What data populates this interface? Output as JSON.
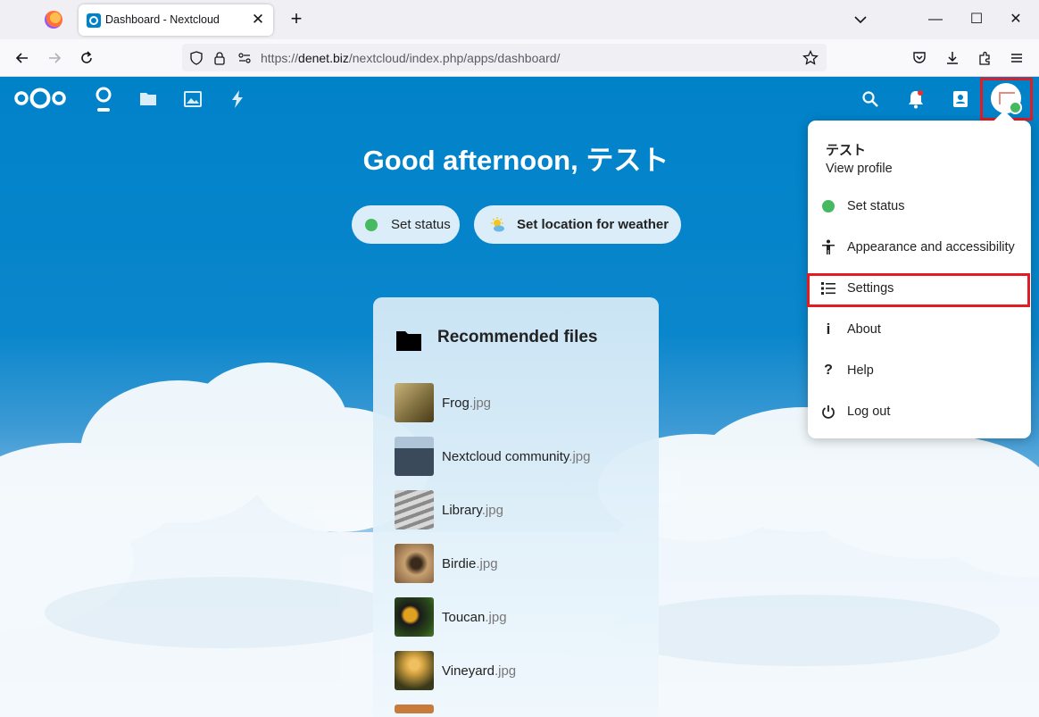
{
  "browser": {
    "tab_title": "Dashboard - Nextcloud",
    "tab_close": "✕",
    "new_tab": "+",
    "url_scheme": "https://",
    "url_host": "denet.biz",
    "url_path": "/nextcloud/index.php/apps/dashboard/",
    "window_minimize": "—",
    "window_maximize": "☐",
    "window_close": "✕"
  },
  "dashboard": {
    "greeting": "Good afternoon, テスト",
    "set_status": "Set status",
    "set_weather": "Set location for weather"
  },
  "recommended": {
    "title": "Recommended files",
    "files": [
      {
        "name": "Frog",
        "ext": ".jpg",
        "color1": "#7a6a3a",
        "color2": "#c9b27a"
      },
      {
        "name": "Nextcloud community",
        "ext": ".jpg",
        "color1": "#3a4a5a",
        "color2": "#8a9aaa"
      },
      {
        "name": "Library",
        "ext": ".jpg",
        "color1": "#8a8a8a",
        "color2": "#d8d8d8"
      },
      {
        "name": "Birdie",
        "ext": ".jpg",
        "color1": "#7a5a3a",
        "color2": "#c8a070"
      },
      {
        "name": "Toucan",
        "ext": ".jpg",
        "color1": "#2a4a1a",
        "color2": "#e0a020"
      },
      {
        "name": "Vineyard",
        "ext": ".jpg",
        "color1": "#3a3a1a",
        "color2": "#d0a040"
      }
    ]
  },
  "user_menu": {
    "display_name": "テスト",
    "view_profile": "View profile",
    "items": [
      {
        "label": "Set status"
      },
      {
        "label": "Appearance and accessibility"
      },
      {
        "label": "Settings"
      },
      {
        "label": "About"
      },
      {
        "label": "Help"
      },
      {
        "label": "Log out"
      }
    ]
  },
  "colors": {
    "nextcloud_blue": "#0082c9",
    "status_green": "#46ba61",
    "highlight_red": "#e31b23"
  }
}
